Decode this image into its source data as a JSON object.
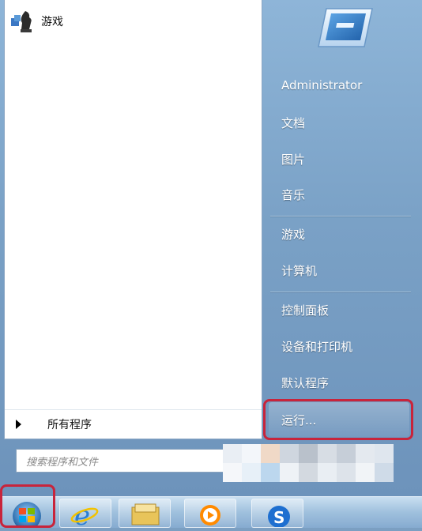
{
  "programs": {
    "items": [
      {
        "label": "游戏",
        "icon": "games-chess-icon"
      }
    ],
    "all_programs_label": "所有程序"
  },
  "search": {
    "placeholder": "搜索程序和文件"
  },
  "right_pane": {
    "user_name": "Administrator",
    "items": [
      "文档",
      "图片",
      "音乐",
      "游戏",
      "计算机",
      "控制面板",
      "设备和打印机",
      "默认程序",
      "运行..."
    ]
  },
  "taskbar": {
    "buttons": [
      "start-orb",
      "internet-explorer",
      "windows-explorer",
      "media-player",
      "sogou"
    ]
  },
  "colors": {
    "highlight_outline": "#c8243b",
    "menu_blue": "#7aa1c6"
  }
}
